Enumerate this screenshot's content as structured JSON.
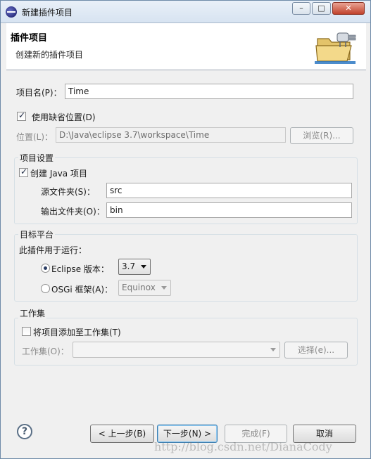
{
  "window": {
    "title": "新建插件项目",
    "minimize_glyph": "–",
    "maximize_glyph": "□",
    "close_glyph": "✕"
  },
  "header": {
    "title": "插件项目",
    "description": "创建新的插件项目",
    "icon": "wizard-folder-plugin-icon"
  },
  "project": {
    "name_label": "项目名(P)：",
    "name_value": "Time",
    "use_default_location_label": "使用缺省位置(D)",
    "use_default_location_checked": true,
    "location_label": "位置(L)：",
    "location_value": "D:\\Java\\eclipse 3.7\\workspace\\Time",
    "browse_label": "浏览(R)..."
  },
  "project_settings": {
    "group_title": "项目设置",
    "create_java_label": "创建 Java 项目",
    "create_java_checked": true,
    "source_folder_label": "源文件夹(S)：",
    "source_folder_value": "src",
    "output_folder_label": "输出文件夹(O)：",
    "output_folder_value": "bin"
  },
  "target_platform": {
    "group_title": "目标平台",
    "run_with_label": "此插件用于运行：",
    "eclipse_label": "Eclipse 版本：",
    "eclipse_selected": true,
    "eclipse_version": "3.7",
    "osgi_label": "OSGi 框架(A)：",
    "osgi_selected": false,
    "osgi_framework": "Equinox"
  },
  "working_set": {
    "group_title": "工作集",
    "add_label": "将项目添加至工作集(T)",
    "add_checked": false,
    "working_sets_label": "工作集(O)：",
    "working_sets_value": "",
    "select_label": "选择(e)..."
  },
  "footer": {
    "back_label": "< 上一步(B)",
    "next_label": "下一步(N) >",
    "finish_label": "完成(F)",
    "cancel_label": "取消",
    "help_glyph": "?"
  },
  "watermark": "http://blog.csdn.net/DianaCody"
}
